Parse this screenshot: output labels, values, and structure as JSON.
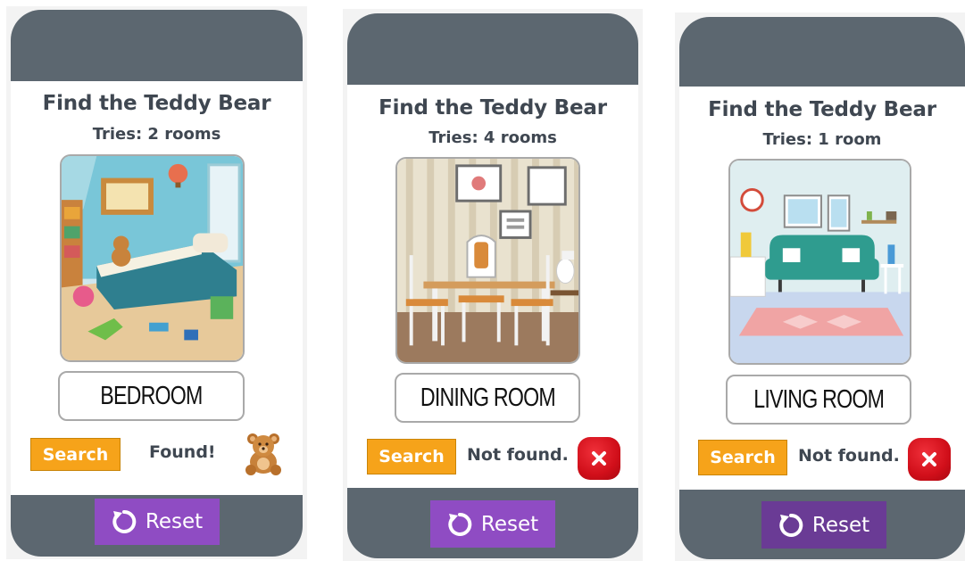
{
  "panels": [
    {
      "title": "Find the Teddy Bear",
      "tries": "Tries: 2 rooms",
      "room_image": "bedroom-illustration",
      "room_label": "BEDROOM",
      "search_label": "Search",
      "status": "Found!",
      "status_icon": "teddy-bear-icon",
      "reset_label": "Reset"
    },
    {
      "title": "Find the Teddy Bear",
      "tries": "Tries: 4 rooms",
      "room_image": "dining-room-illustration",
      "room_label": "DINING ROOM",
      "search_label": "Search",
      "status": "Not found.",
      "status_icon": "close-icon",
      "reset_label": "Reset"
    },
    {
      "title": "Find the Teddy Bear",
      "tries": "Tries: 1 room",
      "room_image": "living-room-illustration",
      "room_label": "LIVING ROOM",
      "search_label": "Search",
      "status": "Not found.",
      "status_icon": "close-icon",
      "reset_label": "Reset"
    }
  ],
  "colors": {
    "frame": "#5c6770",
    "search": "#f6a31a",
    "reset": "#8f4cc3",
    "reset_pressed": "#6a3b95",
    "not_found_icon": "#d10f1a",
    "text": "#3f4751"
  }
}
